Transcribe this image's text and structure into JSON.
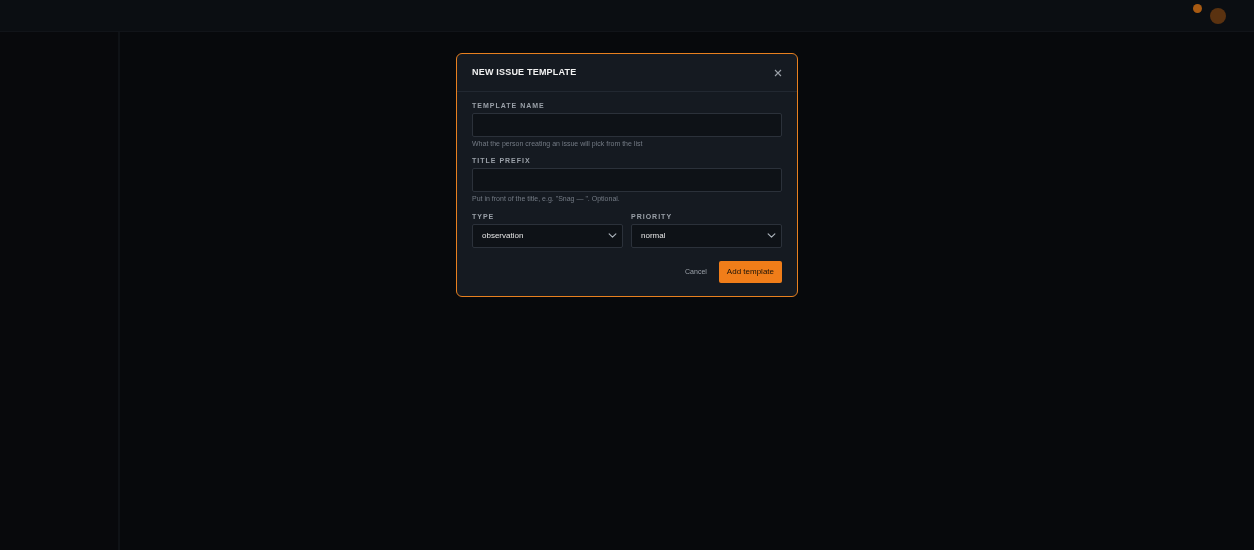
{
  "dialog": {
    "title": "NEW ISSUE TEMPLATE",
    "fields": [
      {
        "kind": "text",
        "label": "TEMPLATE NAME",
        "help": "What the person creating an issue will pick from the list"
      },
      {
        "kind": "text",
        "label": "TITLE PREFIX",
        "help": "Put in front of the title, e.g. \"Snag — \". Optional."
      }
    ],
    "selects": [
      {
        "label": "TYPE",
        "value": "observation"
      },
      {
        "label": "PRIORITY",
        "value": "normal"
      }
    ],
    "buttons": [
      {
        "kind": "link",
        "label": "Cancel"
      },
      {
        "kind": "primary",
        "label": "Add template"
      }
    ]
  }
}
